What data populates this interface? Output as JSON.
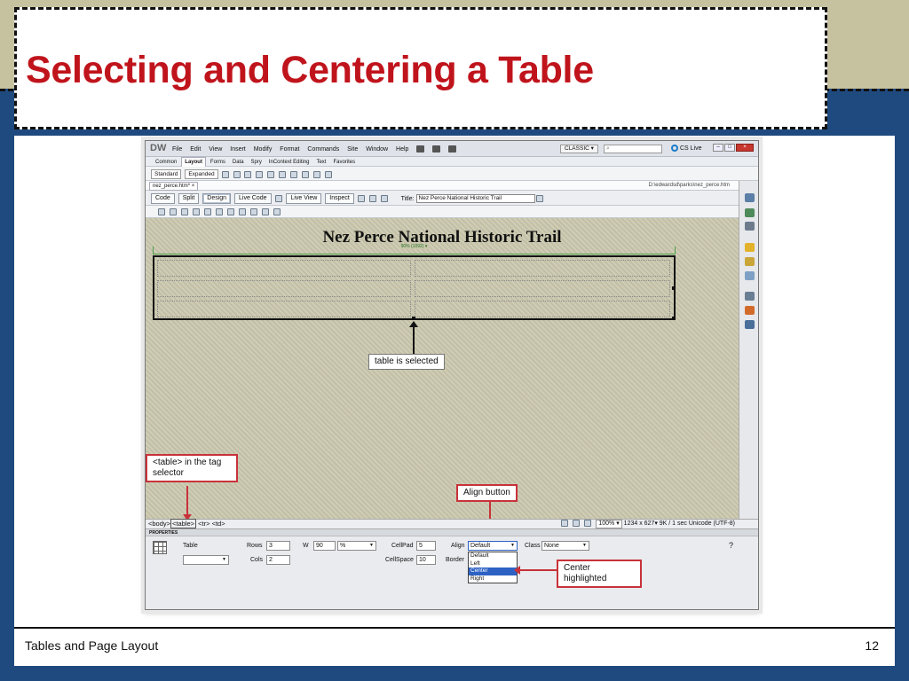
{
  "slide": {
    "title": "Selecting and Centering a Table",
    "footer_left": "Tables and Page Layout",
    "page_number": "12",
    "colors": {
      "title": "#c0141c",
      "accent_blue": "#1f4a7f",
      "accent_tan": "#c6c2a0",
      "callout_border": "#c8323a"
    }
  },
  "app": {
    "logo": "DW",
    "menu": [
      "File",
      "Edit",
      "View",
      "Insert",
      "Modify",
      "Format",
      "Commands",
      "Site",
      "Window",
      "Help"
    ],
    "workspace": "CLASSIC ▾",
    "search_icon": "search-icon",
    "cs_live": "CS Live",
    "insert_tabs": [
      "Common",
      "Layout",
      "Forms",
      "Data",
      "Spry",
      "InContext Editing",
      "Text",
      "Favorites"
    ],
    "insert_active": "Layout",
    "mode_buttons": [
      "Standard",
      "Expanded"
    ],
    "doc_tab": "nez_perce.htm* ×",
    "doc_path": "D:\\edwardsd\\parks\\nez_perce.htm",
    "view_buttons": {
      "code": "Code",
      "split": "Split",
      "design": "Design",
      "live_code": "Live Code",
      "live_view": "Live View",
      "inspect": "Inspect"
    },
    "title_label": "Title:",
    "title_value": "Nez Perce National Historic Trail"
  },
  "design": {
    "heading": "Nez Perce National Historic Trail",
    "width_label": "90% (1092) ▾"
  },
  "callouts": {
    "table_selected": "table is selected",
    "tag_selector": "<table> in the tag selector",
    "align_button": "Align button",
    "center_highlighted": "Center highlighted"
  },
  "status": {
    "tags": [
      "<body>",
      "<table>",
      "<tr>",
      "<td>"
    ],
    "zoom": "100% ▾",
    "size": "1234 x 627▾",
    "weight": "9K / 1 sec",
    "encoding": "Unicode (UTF-8)"
  },
  "properties": {
    "header": "PROPERTIES",
    "type": "Table",
    "rows_label": "Rows",
    "rows": "3",
    "cols_label": "Cols",
    "cols": "2",
    "w_label": "W",
    "w": "90",
    "w_unit": "%",
    "cellpad_label": "CellPad",
    "cellpad": "5",
    "cellspace_label": "CellSpace",
    "cellspace": "10",
    "align_label": "Align",
    "align": "Default",
    "border_label": "Border",
    "class_label": "Class",
    "class": "None",
    "align_options": [
      "Default",
      "Left",
      "Center",
      "Right"
    ],
    "align_highlighted": "Center"
  }
}
